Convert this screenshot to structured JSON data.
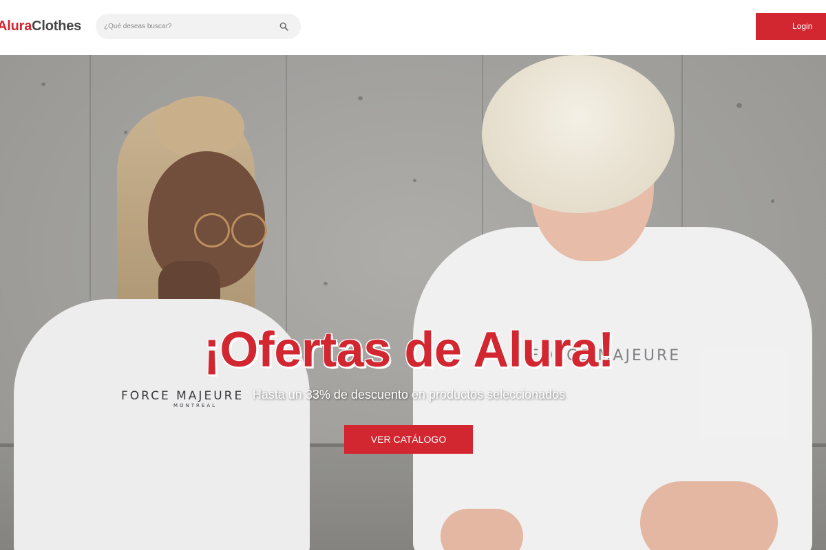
{
  "header": {
    "logo_part1": "Alura",
    "logo_part2": "Clothes",
    "search_placeholder": "¿Qué deseas buscar?",
    "search_icon": "search-icon",
    "login_label": "Login"
  },
  "hero": {
    "title": "¡Ofertas de Alura!",
    "subtitle": "Hasta un 33% de descuento en productos seleccionados",
    "cta_label": "VER CATÁLOGO",
    "tee_print_main": "FORCE MAJEURE",
    "tee_print_sub": "MONTREAL",
    "tee_print_right": "FORCE MAJEURE"
  },
  "colors": {
    "brand_red": "#d22630",
    "logo_dark": "#464646",
    "search_bg": "#f2f2f2"
  }
}
